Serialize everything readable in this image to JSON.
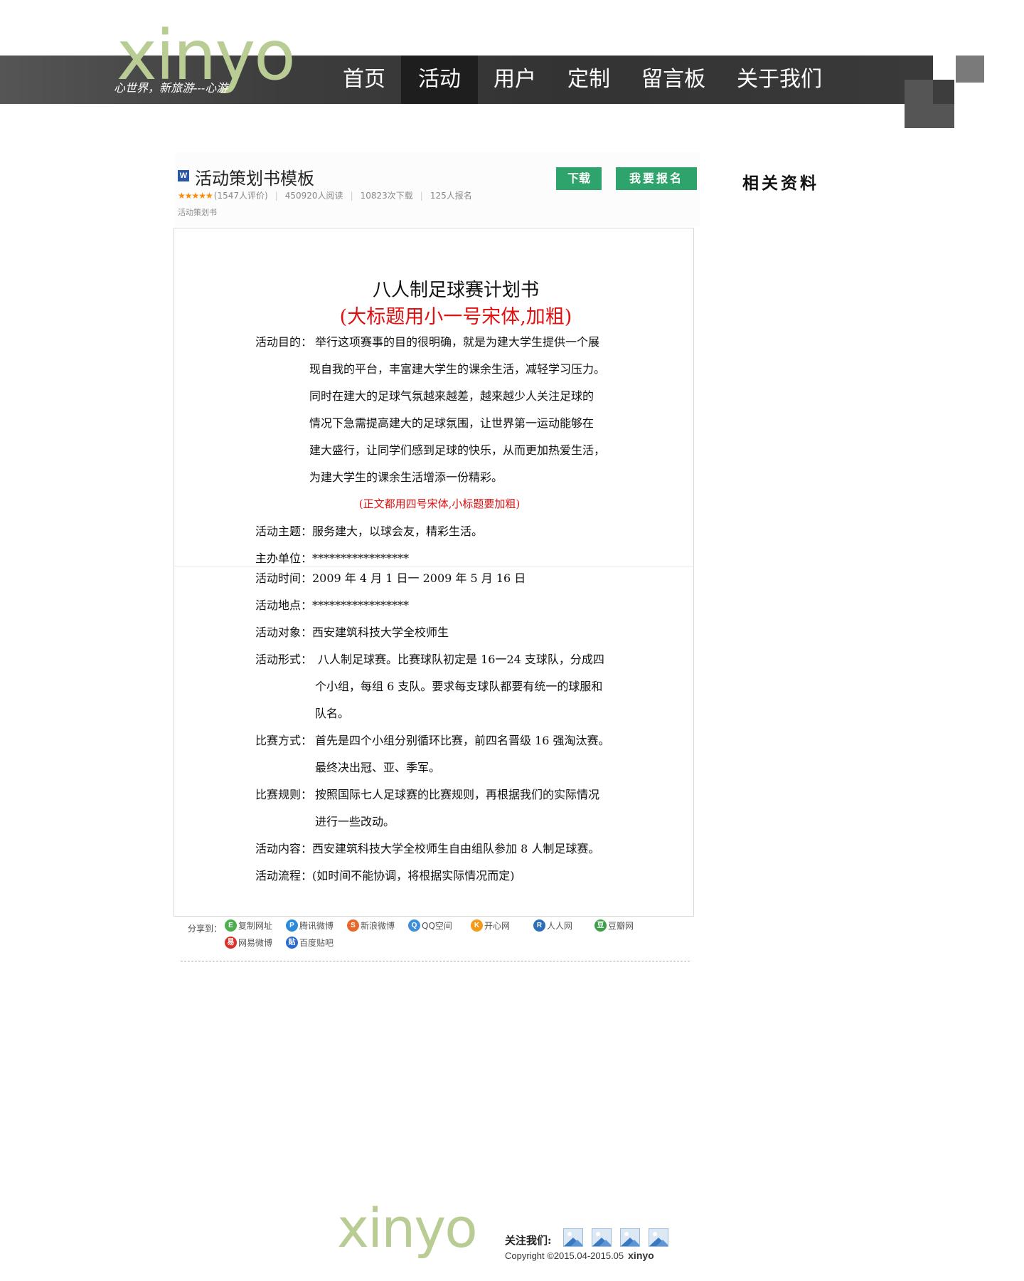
{
  "header": {
    "logo_text": "xinyo",
    "tagline": "心世界，新旅游---心游",
    "nav": [
      {
        "label": "首页",
        "active": false
      },
      {
        "label": "活动",
        "active": true
      },
      {
        "label": "用户",
        "active": false
      },
      {
        "label": "定制",
        "active": false
      },
      {
        "label": "留言板",
        "active": false
      },
      {
        "label": "关于我们",
        "active": false
      }
    ]
  },
  "doc": {
    "file_icon": "W",
    "title": "活动策划书模板",
    "stars": "★★★★★",
    "rating": "(1547人评价)",
    "reads": "450920人阅读",
    "downloads": "10823次下载",
    "signups": "125人报名",
    "tag": "活动策划书",
    "download_label": "下载",
    "signup_label": "我要报名"
  },
  "sidebar": {
    "title": "相关资料"
  },
  "page": {
    "title": "八人制足球赛计划书",
    "subtitle": "(大标题用小一号宋体,加粗)",
    "purpose_label": "活动目的：",
    "purpose_lines": [
      "举行这项赛事的目的很明确，就是为建大学生提供一个展",
      "现自我的平台，丰富建大学生的课余生活，减轻学习压力。",
      "同时在建大的足球气氛越来越差，越来越少人关注足球的",
      "情况下急需提高建大的足球氛围，让世界第一运动能够在",
      "建大盛行，让同学们感到足球的快乐，从而更加热爱生活，",
      "为建大学生的课余生活增添一份精彩。"
    ],
    "note": "(正文都用四号宋体,小标题要加粗)",
    "theme": "活动主题：服务建大，以球会友，精彩生活。",
    "organizer": "主办单位：*****************",
    "time": "活动时间：2009 年 4 月 1 日一 2009 年 5 月 16 日",
    "place": "活动地点：*****************",
    "audience": "活动对象：西安建筑科技大学全校师生",
    "form_label": "活动形式：",
    "form_lines": [
      "八人制足球赛。比赛球队初定是 16一24 支球队，分成四",
      "个小组，每组 6 支队。要求每支球队都要有统一的球服和",
      "队名。"
    ],
    "method_label": "比赛方式：",
    "method_lines": [
      "首先是四个小组分别循环比赛，前四名晋级 16 强淘汰赛。",
      "最终决出冠、亚、季军。"
    ],
    "rules_label": "比赛规则：",
    "rules_lines": [
      "按照国际七人足球赛的比赛规则，再根据我们的实际情况",
      "进行一些改动。"
    ],
    "content": "活动内容：西安建筑科技大学全校师生自由组队参加 8 人制足球赛。",
    "flow": "活动流程：(如时间不能协调，将根据实际情况而定)"
  },
  "share": {
    "label": "分享到：",
    "items": [
      {
        "label": "复制网址",
        "icon": "copy-link-icon",
        "glyph": "E",
        "color": "#4caf50"
      },
      {
        "label": "腾讯微博",
        "icon": "tencent-weibo-icon",
        "glyph": "P",
        "color": "#2b8bd8"
      },
      {
        "label": "新浪微博",
        "icon": "sina-weibo-icon",
        "glyph": "S",
        "color": "#e8682b"
      },
      {
        "label": "QQ空间",
        "icon": "qzone-icon",
        "glyph": "Q",
        "color": "#3c8fd8"
      },
      {
        "label": "开心网",
        "icon": "kaixin-icon",
        "glyph": "K",
        "color": "#f39a1b"
      },
      {
        "label": "人人网",
        "icon": "renren-icon",
        "glyph": "R",
        "color": "#2c6fb8"
      },
      {
        "label": "豆瓣网",
        "icon": "douban-icon",
        "glyph": "豆",
        "color": "#3ea04a"
      },
      {
        "label": "网易微博",
        "icon": "netease-weibo-icon",
        "glyph": "易",
        "color": "#d8322b"
      },
      {
        "label": "百度贴吧",
        "icon": "baidu-tieba-icon",
        "glyph": "贴",
        "color": "#2a6bd0"
      }
    ]
  },
  "footer": {
    "logo_text": "xinyo",
    "follow_label": "关注我们:",
    "copyright": "Copyright ©2015.04-2015.05",
    "brand": "xinyo"
  }
}
